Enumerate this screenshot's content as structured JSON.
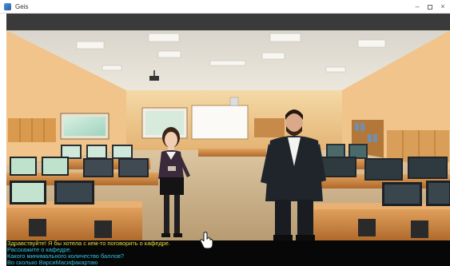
{
  "window": {
    "title": "Geis",
    "minimize_glyph": "–",
    "close_glyph": "×"
  },
  "scene": {
    "location": "computer classroom",
    "characters": [
      "female-student",
      "male-lecturer"
    ]
  },
  "dialog": {
    "npc_line": "Здравствуйте! Я бы хотела с кем-то поговорить о кафедре.",
    "options": [
      "Расскажите о кафедре.",
      "Какого минимального количество баллов?",
      "Во сколько ВарсиМасифакартаю"
    ]
  },
  "colors": {
    "npc_text": "#e6de3c",
    "option_text": "#2ec4e0",
    "dialog_bg": "#070707"
  },
  "icons": [
    "app-icon",
    "minimize-icon",
    "maximize-icon",
    "close-icon",
    "hand-cursor-icon"
  ]
}
